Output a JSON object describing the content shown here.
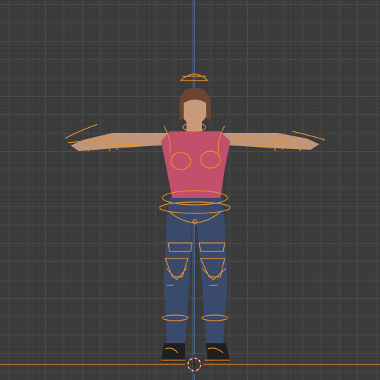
{
  "viewport": {
    "view": "front-orthographic",
    "grid_color": "#4a4a4a",
    "background_color": "#3d3d3d",
    "z_axis_color": "#3b6fb6",
    "ground_line_color": "#c9772a",
    "rig_color": "#e8922e"
  },
  "character": {
    "skin_color": "#c79a7c",
    "hair_color": "#6b4530",
    "top_color": "#c2506a",
    "pants_color": "#3a4a6c",
    "shoe_color": "#1f1f1f"
  },
  "icons": {
    "origin": "3d-cursor-icon"
  }
}
